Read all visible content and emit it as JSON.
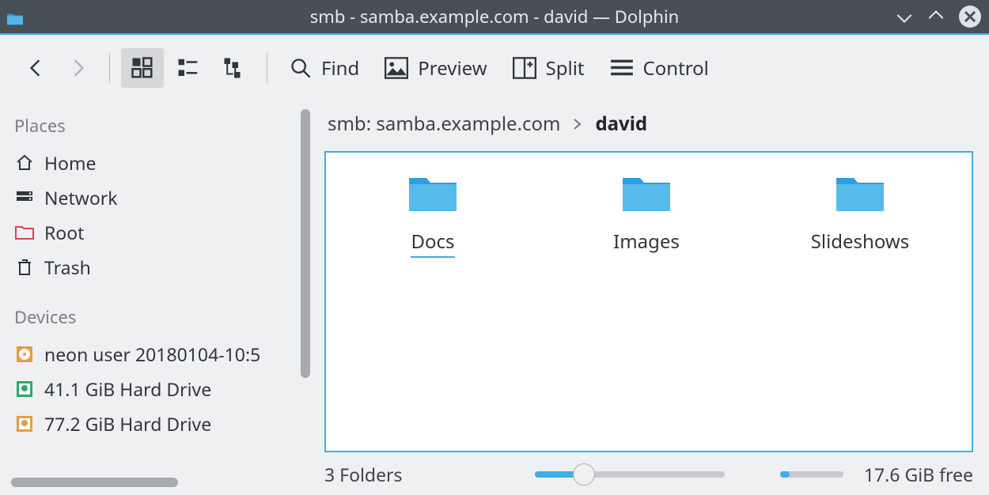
{
  "window": {
    "title": "smb - samba.example.com - david — Dolphin"
  },
  "toolbar": {
    "find": "Find",
    "preview": "Preview",
    "split": "Split",
    "control": "Control"
  },
  "sidebar": {
    "places_title": "Places",
    "places": [
      {
        "label": "Home"
      },
      {
        "label": "Network"
      },
      {
        "label": "Root"
      },
      {
        "label": "Trash"
      }
    ],
    "devices_title": "Devices",
    "devices": [
      {
        "label": "neon user 20180104-10:5"
      },
      {
        "label": "41.1 GiB Hard Drive"
      },
      {
        "label": "77.2 GiB Hard Drive"
      }
    ]
  },
  "breadcrumb": {
    "root": "smb: samba.example.com",
    "current": "david"
  },
  "folders": [
    {
      "label": "Docs",
      "selected": true
    },
    {
      "label": "Images",
      "selected": false
    },
    {
      "label": "Slideshows",
      "selected": false
    }
  ],
  "status": {
    "folder_count": "3 Folders",
    "free": "17.6 GiB free"
  }
}
